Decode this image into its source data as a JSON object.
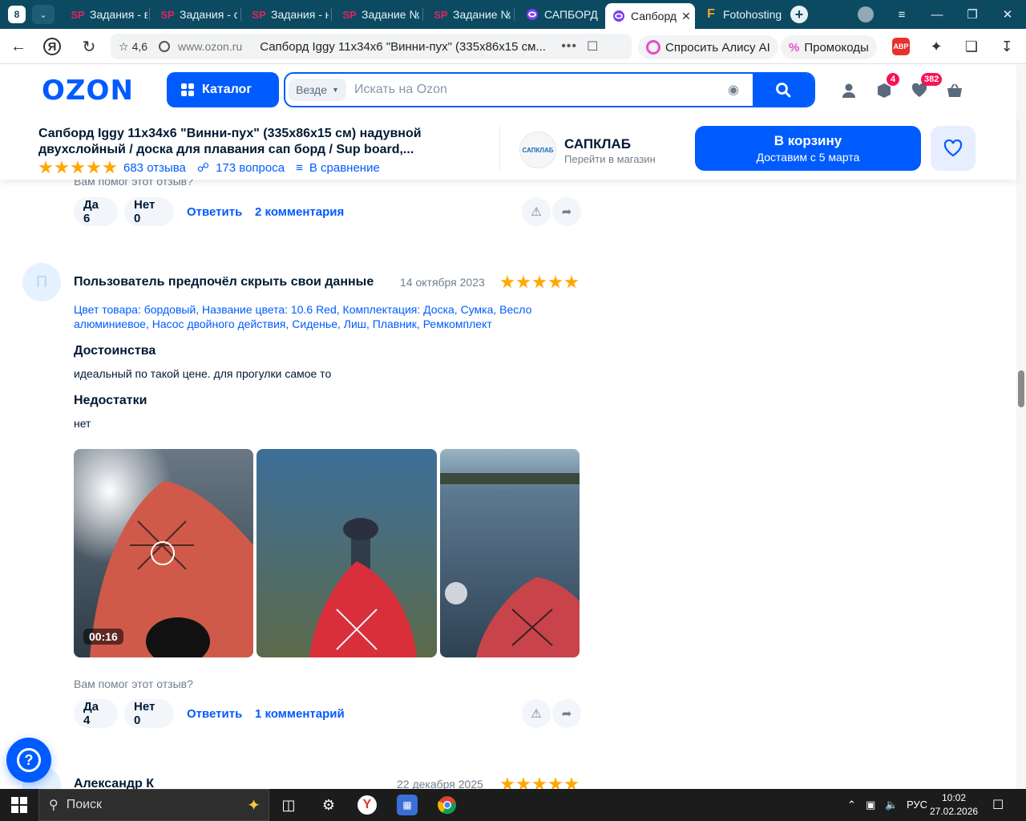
{
  "browser": {
    "tab_count": "8",
    "tabs": [
      {
        "icon": "SP",
        "label": "Задания - в"
      },
      {
        "icon": "SP",
        "label": "Задания - с"
      },
      {
        "icon": "SP",
        "label": "Задания - н"
      },
      {
        "icon": "SP",
        "label": "Задание №"
      },
      {
        "icon": "SP",
        "label": "Задание №"
      },
      {
        "icon": "ozon-icon",
        "label": "САПБОРД"
      },
      {
        "icon": "ozon-icon",
        "label": "Сапборд"
      },
      {
        "icon": "F",
        "label": "Fotohosting"
      }
    ],
    "site_rating": "4,6",
    "domain": "www.ozon.ru",
    "page_title": "Сапборд Iggy 11x34x6 \"Винни-пух\" (335x86x15 см...",
    "alice_label": "Спросить Алису AI",
    "promo_label": "Промокоды",
    "abp_label": "ABP"
  },
  "header": {
    "logo": "OZON",
    "catalog_label": "Каталог",
    "search_scope": "Везде",
    "search_placeholder": "Искать на Ozon",
    "orders_badge": "4",
    "favorites_badge": "382"
  },
  "product": {
    "title": "Сапборд Iggy 11x34x6 \"Винни-пух\" (335x86x15 см) надувной двухслойный / доска для плавания сап борд / Sup board,...",
    "rating_stars": 5,
    "reviews_link": "683 отзыва",
    "questions_link": "173 вопроса",
    "compare_link": "В сравнение",
    "seller_logo_text": "САПКЛАБ",
    "seller_name": "САПКЛАБ",
    "seller_sub": "Перейти в магазин",
    "cart_label": "В корзину",
    "delivery_label": "Доставим с 5 марта"
  },
  "prev_review": {
    "helpful_q": "Вам помог этот отзыв?",
    "yes": "Да 6",
    "no": "Нет 0",
    "reply": "Ответить",
    "comments": "2 комментария"
  },
  "review": {
    "avatar_letter": "П",
    "author": "Пользователь предпочёл скрыть свои данные",
    "date": "14 октября 2023",
    "stars": 5,
    "variant": "Цвет товара: бордовый, Название цвета: 10.6 Red, Комплектация: Доска, Сумка, Весло алюминиевое, Насос двойного действия, Сиденье, Лиш, Плавник, Ремкомплект",
    "pros_title": "Достоинства",
    "pros": "идеальный по такой цене. для прогулки самое то",
    "cons_title": "Недостатки",
    "cons": "нет",
    "video_duration": "00:16",
    "helpful_q": "Вам помог этот отзыв?",
    "yes": "Да 4",
    "no": "Нет 0",
    "reply": "Ответить",
    "comments": "1 комментарий"
  },
  "next_review": {
    "author": "Александр К",
    "date": "22 декабря 2025",
    "stars": 5
  },
  "taskbar": {
    "search_label": "Поиск",
    "lang": "РУС",
    "time": "10:02",
    "date": "27.02.2026"
  },
  "colors": {
    "ozon_blue": "#005bff",
    "star_orange": "#ffa800",
    "badge_pink": "#f91155",
    "tabstrip": "#0c4a62"
  }
}
